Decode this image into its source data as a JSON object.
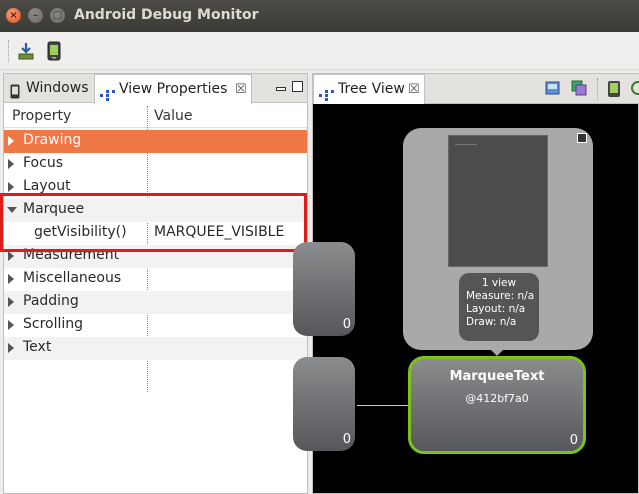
{
  "window": {
    "title": "Android Debug Monitor",
    "close": "×",
    "minimize": "–",
    "maximize": "□"
  },
  "toolbar": {
    "icons": [
      "download-icon",
      "android-device-icon"
    ]
  },
  "left_panel": {
    "tabs": [
      {
        "label": "Windows",
        "icon": "phone-icon"
      },
      {
        "label": "View Properties",
        "icon": "hierarchy-icon",
        "close": "☒"
      }
    ],
    "columns": {
      "property": "Property",
      "value": "Value"
    },
    "rows": [
      {
        "name": "Drawing",
        "value": "",
        "expanded": false,
        "selected": true
      },
      {
        "name": "Focus",
        "value": "",
        "expanded": false
      },
      {
        "name": "Layout",
        "value": "",
        "expanded": false
      },
      {
        "name": "Marquee",
        "value": "",
        "expanded": true
      },
      {
        "name": "getVisibility()",
        "value": "MARQUEE_VISIBLE",
        "child": true
      },
      {
        "name": "Measurement",
        "value": "",
        "expanded": false
      },
      {
        "name": "Miscellaneous",
        "value": "",
        "expanded": false
      },
      {
        "name": "Padding",
        "value": "",
        "expanded": false
      },
      {
        "name": "Scrolling",
        "value": "",
        "expanded": false
      },
      {
        "name": "Text",
        "value": "",
        "expanded": false
      }
    ],
    "highlight_color": "#e01b1b",
    "selected_color": "#f07746"
  },
  "right_panel": {
    "tab": {
      "label": "Tree View",
      "close": "☒"
    },
    "preview_node": {
      "views": "1 view",
      "measure": "Measure: n/a",
      "layout": "Layout: n/a",
      "draw": "Draw: n/a"
    },
    "selected_node": {
      "title": "MarqueeText",
      "id": "@412bf7a0",
      "count": "0",
      "border_color": "#7cc21b"
    },
    "left_nodes": [
      {
        "count": "0"
      },
      {
        "count": "0"
      }
    ]
  }
}
